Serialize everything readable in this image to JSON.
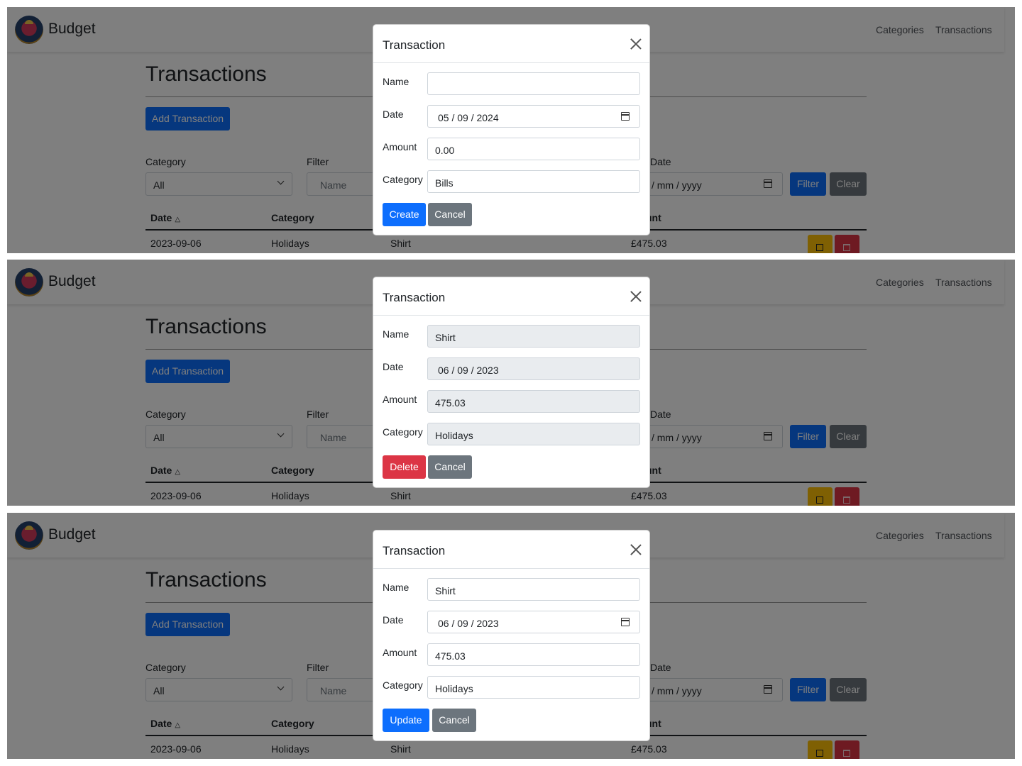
{
  "app": {
    "brand": "Budget",
    "nav": [
      "Categories",
      "Transactions"
    ]
  },
  "page": {
    "title": "Transactions",
    "add_button": "Add Transaction",
    "filters": {
      "category_label": "Category",
      "category_value": "All",
      "filter_label": "Filter",
      "filter_placeholder": "Name",
      "to_date_label": "Date",
      "to_date_placeholder": "/ mm / yyyy",
      "filter_button": "Filter",
      "clear_button": "Clear"
    },
    "table": {
      "headers": {
        "date": "Date",
        "category": "Category",
        "amount": "unt"
      },
      "sort_icon": "△",
      "rows": [
        {
          "date": "2023-09-06",
          "category": "Holidays",
          "name": "Shirt",
          "amount": "£475.03"
        }
      ]
    }
  },
  "modals": [
    {
      "title": "Transaction",
      "mode": "create",
      "fields": {
        "name_label": "Name",
        "name_value": "",
        "date_label": "Date",
        "date_value": "05 / 09 / 2024",
        "amount_label": "Amount",
        "amount_value": "0.00",
        "category_label": "Category",
        "category_value": "Bills"
      },
      "primary_button": "Create",
      "cancel_button": "Cancel"
    },
    {
      "title": "Transaction",
      "mode": "delete",
      "fields": {
        "name_label": "Name",
        "name_value": "Shirt",
        "date_label": "Date",
        "date_value": "06 / 09 / 2023",
        "amount_label": "Amount",
        "amount_value": "475.03",
        "category_label": "Category",
        "category_value": "Holidays"
      },
      "primary_button": "Delete",
      "cancel_button": "Cancel"
    },
    {
      "title": "Transaction",
      "mode": "update",
      "fields": {
        "name_label": "Name",
        "name_value": "Shirt",
        "date_label": "Date",
        "date_value": "06 / 09 / 2023",
        "amount_label": "Amount",
        "amount_value": "475.03",
        "category_label": "Category",
        "category_value": "Holidays"
      },
      "primary_button": "Update",
      "cancel_button": "Cancel"
    }
  ],
  "colors": {
    "primary": "#0d6efd",
    "secondary": "#6c757d",
    "danger": "#dc3545",
    "warning": "#ffc107",
    "readonly_bg": "#e9ecef"
  },
  "icons": [
    "logo-icon",
    "close-icon",
    "calendar-icon",
    "chevron-down-icon",
    "sort-up-icon",
    "edit-icon",
    "trash-icon"
  ]
}
